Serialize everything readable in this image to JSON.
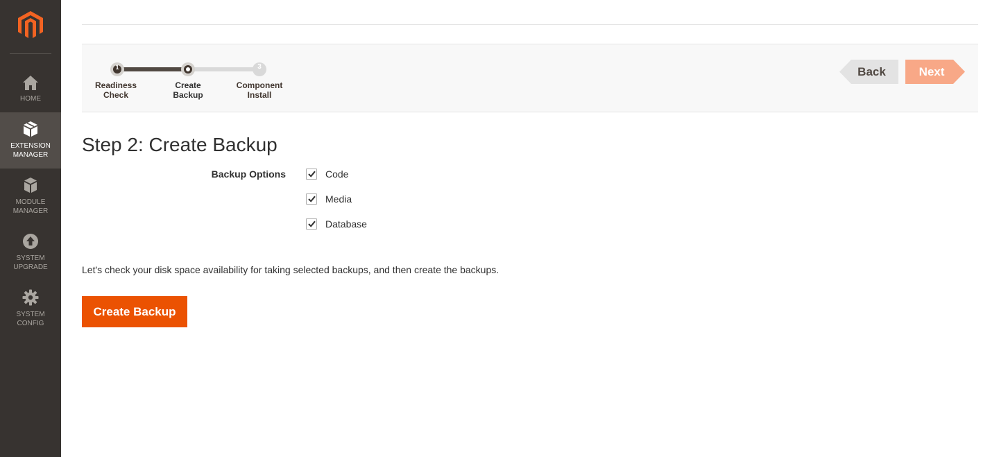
{
  "sidebar": {
    "logo": "magento-logo",
    "items": [
      {
        "label_lines": [
          "HOME"
        ],
        "icon": "home-icon",
        "active": false
      },
      {
        "label_lines": [
          "EXTENSION",
          "MANAGER"
        ],
        "icon": "extension-box-icon",
        "active": true
      },
      {
        "label_lines": [
          "MODULE",
          "MANAGER"
        ],
        "icon": "module-box-icon",
        "active": false
      },
      {
        "label_lines": [
          "SYSTEM",
          "UPGRADE"
        ],
        "icon": "upgrade-arrow-icon",
        "active": false
      },
      {
        "label_lines": [
          "SYSTEM",
          "CONFIG"
        ],
        "icon": "gear-icon",
        "active": false
      }
    ]
  },
  "wizard": {
    "steps": [
      {
        "number": "1",
        "label_lines": [
          "Readiness",
          "Check"
        ],
        "state": "complete"
      },
      {
        "number": "",
        "label_lines": [
          "Create",
          "Backup"
        ],
        "state": "current"
      },
      {
        "number": "3",
        "label_lines": [
          "Component",
          "Install"
        ],
        "state": "pending"
      }
    ],
    "back_label": "Back",
    "next_label": "Next"
  },
  "content": {
    "title": "Step 2: Create Backup",
    "backup_options_label": "Backup Options",
    "options": [
      {
        "label": "Code",
        "checked": true
      },
      {
        "label": "Media",
        "checked": true
      },
      {
        "label": "Database",
        "checked": true
      }
    ],
    "info_text": "Let's check your disk space availability for taking selected backups, and then create the backups.",
    "create_button_label": "Create Backup"
  },
  "colors": {
    "sidebar_bg": "#373330",
    "sidebar_active": "#524d49",
    "accent": "#eb5202",
    "next_disabled": "#f8a887",
    "logo": "#f26322"
  }
}
